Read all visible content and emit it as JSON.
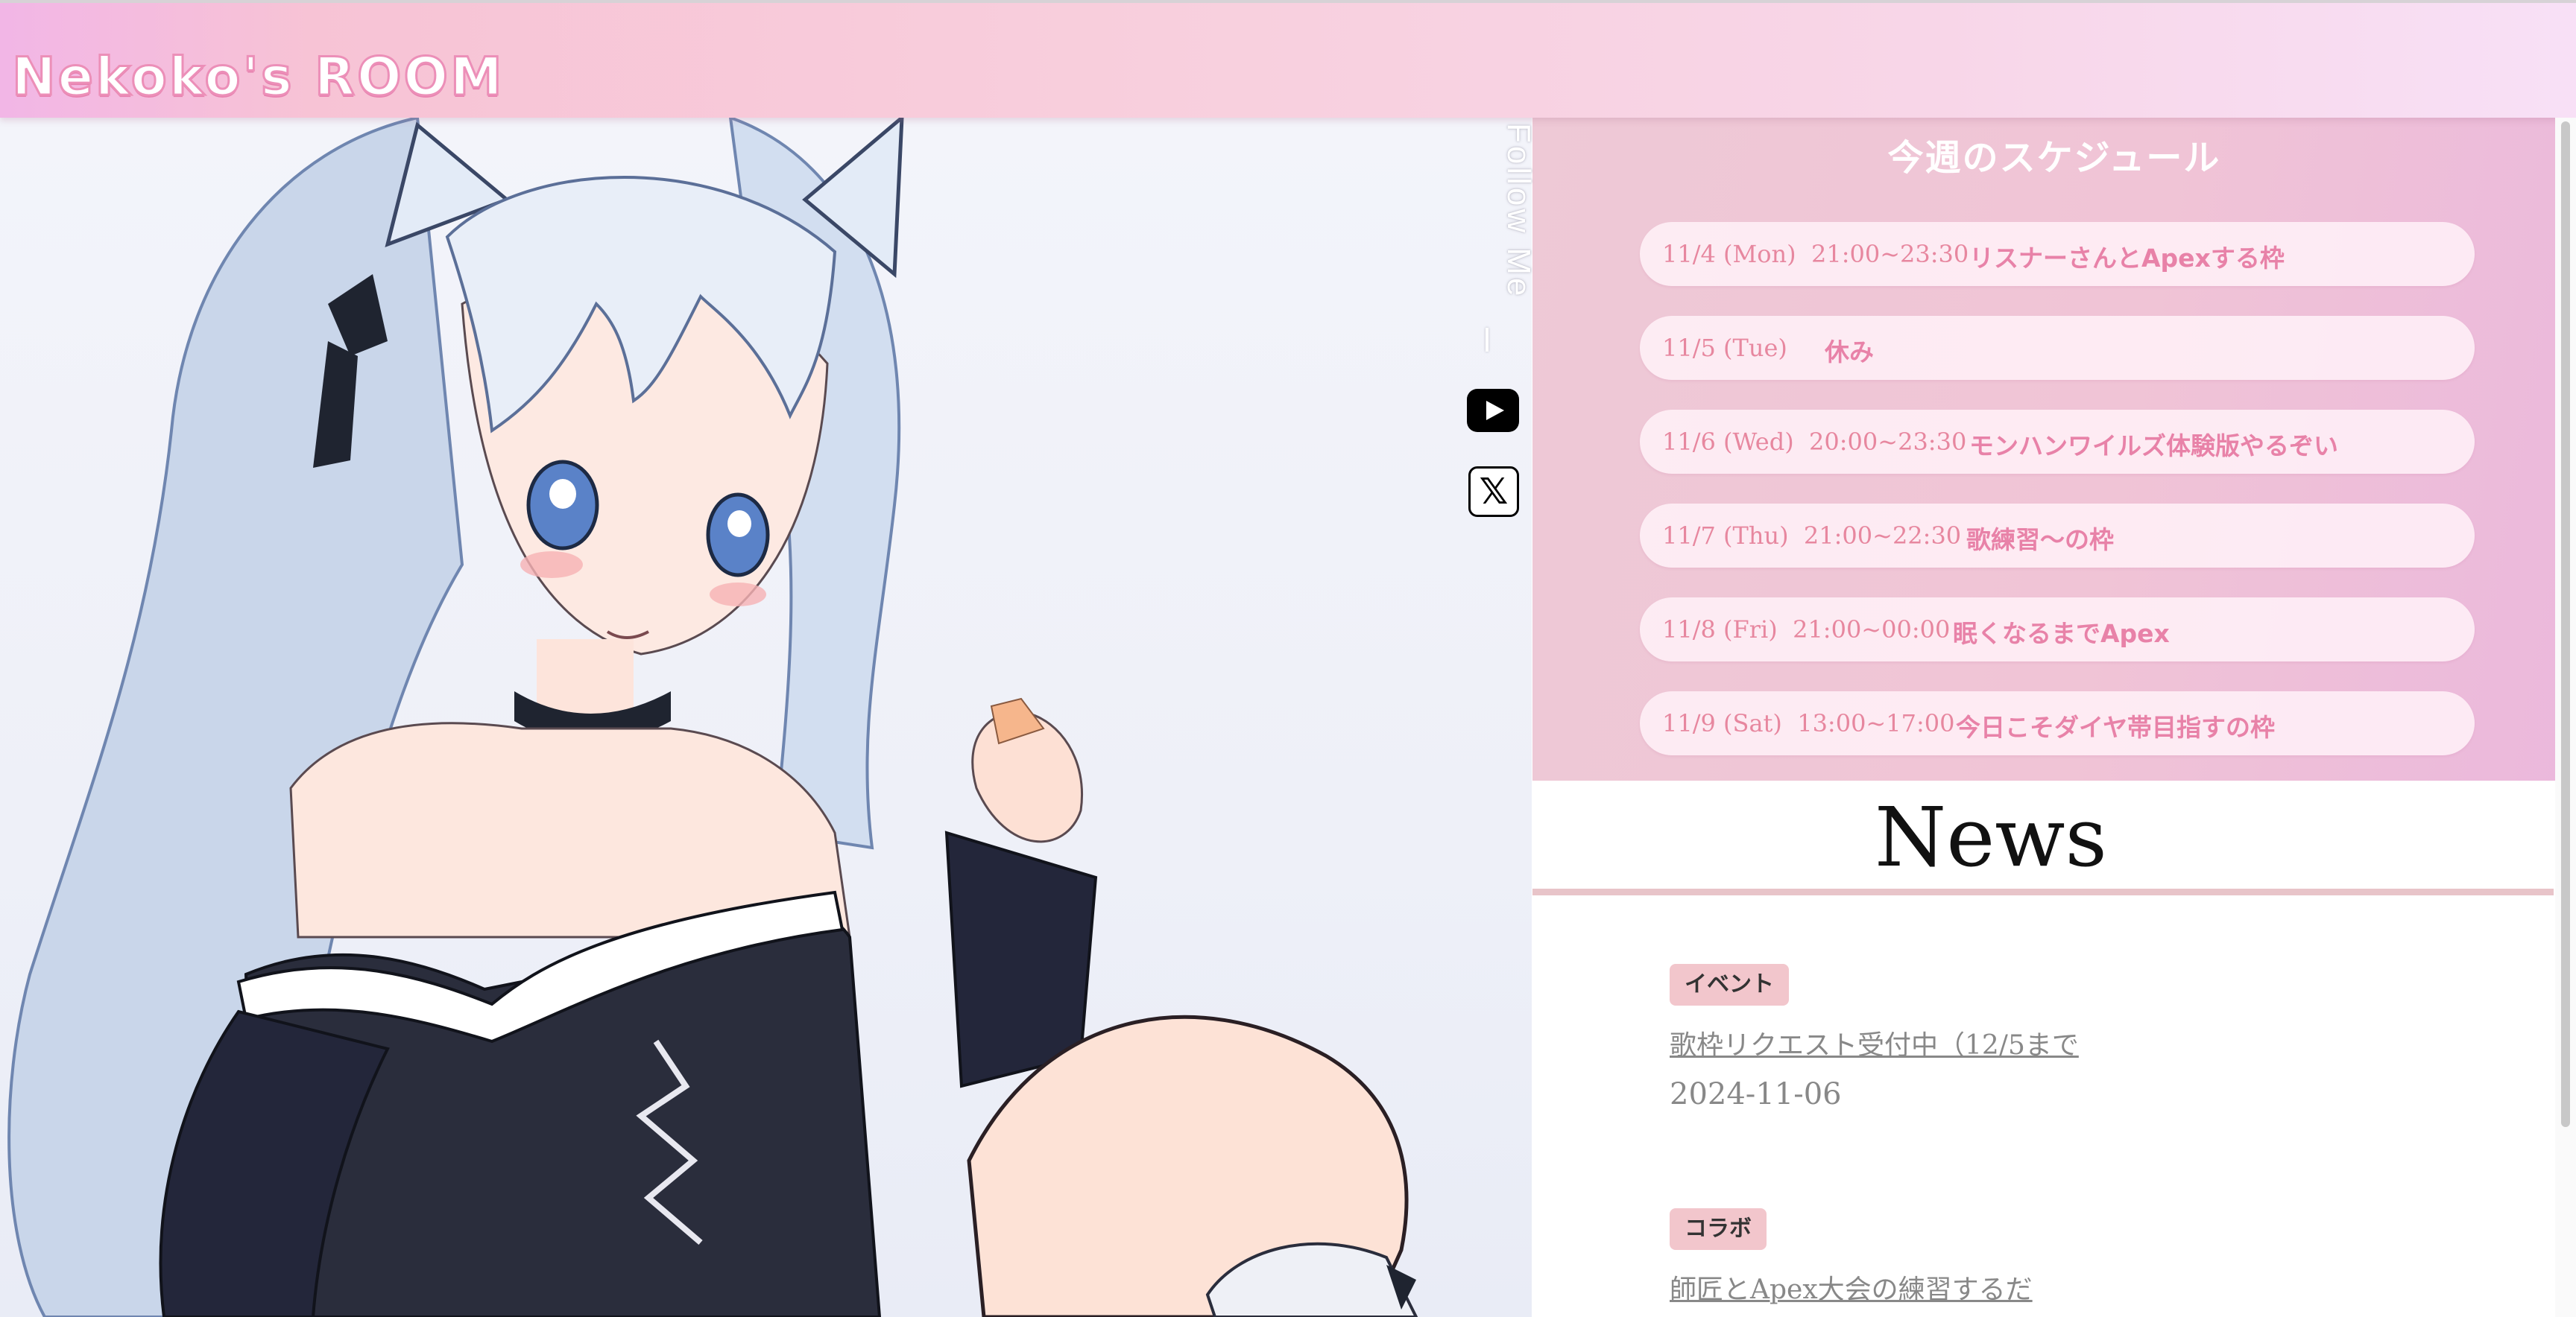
{
  "header": {
    "logo": "Nekoko's ROOM"
  },
  "follow": {
    "label": "Follow Me",
    "youtube_icon": "youtube-icon",
    "x_icon": "x-icon",
    "x_glyph": "𝕏"
  },
  "schedule": {
    "title": "今週のスケジュール",
    "items": [
      {
        "date": "11/4 (Mon)  21:00~23:30",
        "title": "リスナーさんとApexする枠"
      },
      {
        "date": "11/5 (Tue)",
        "title": "休み"
      },
      {
        "date": "11/6 (Wed)  20:00~23:30",
        "title": "モンハンワイルズ体験版やるぞい"
      },
      {
        "date": "11/7 (Thu)  21:00~22:30",
        "title": "歌練習～の枠"
      },
      {
        "date": "11/8 (Fri)  21:00~00:00",
        "title": "眠くなるまでApex"
      },
      {
        "date": "11/9 (Sat)  13:00~17:00",
        "title": "今日こそダイヤ帯目指すの枠"
      }
    ]
  },
  "news": {
    "heading": "News",
    "items": [
      {
        "tag": "イベント",
        "title": "歌枠リクエスト受付中（12/5まで",
        "date": "2024-11-06"
      },
      {
        "tag": "コラボ",
        "title": "師匠とApex大会の練習するだ"
      }
    ]
  },
  "colors": {
    "accent": "#e882a8",
    "schedule_bg": "#f0c4d6",
    "tag_bg": "#f2c6cc"
  }
}
